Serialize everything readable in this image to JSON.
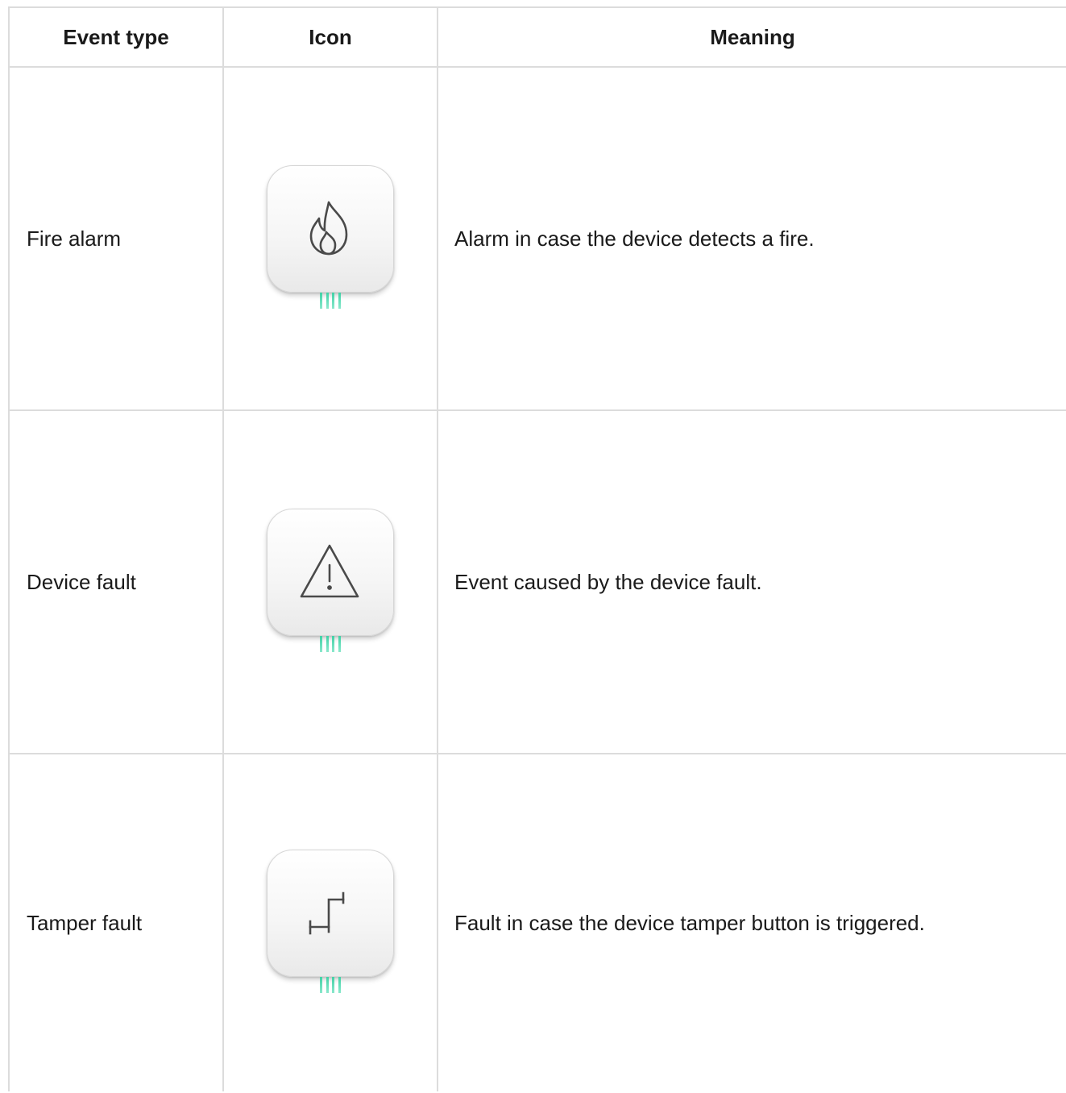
{
  "table": {
    "headers": {
      "event_type": "Event type",
      "icon": "Icon",
      "meaning": "Meaning"
    },
    "rows": [
      {
        "event_type": "Fire alarm",
        "icon": "fire-icon",
        "meaning": "Alarm in case the device detects a fire."
      },
      {
        "event_type": "Device fault",
        "icon": "warning-triangle-icon",
        "meaning": "Event caused by the device fault."
      },
      {
        "event_type": "Tamper fault",
        "icon": "tamper-icon",
        "meaning": "Fault in case the device tamper button is triggered."
      }
    ]
  },
  "colors": {
    "border": "#dcdcdc",
    "text": "#1a1a1a",
    "icon_stroke": "#4a4a4a",
    "led": "#3fd2a6"
  }
}
